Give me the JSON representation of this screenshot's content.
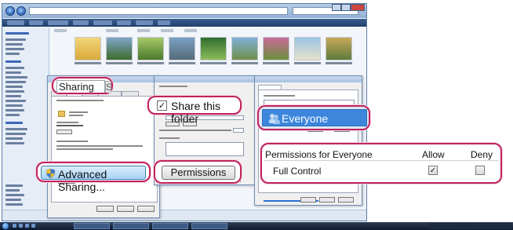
{
  "callouts": {
    "sharing_tab": {
      "label": "Sharing",
      "next_tab_fragment": "S"
    },
    "share_folder": {
      "label": "Share this folder",
      "checked": true
    },
    "user_entry": {
      "label": "Everyone",
      "selected": true
    },
    "permissions_table": {
      "header": "Permissions for Everyone",
      "allow_header": "Allow",
      "deny_header": "Deny",
      "rows": [
        {
          "name": "Full Control",
          "allow": true,
          "deny": false
        }
      ]
    },
    "advanced_sharing_button": {
      "label": "Advanced Sharing..."
    },
    "permissions_button": {
      "label": "Permissions"
    }
  },
  "colors": {
    "callout_border": "#c0235f",
    "selection_blue": "#3d86dc",
    "taskbar": "#0f1a2d"
  },
  "icons": {
    "users": "users-icon",
    "shield": "shield-icon",
    "folder": "folder-icon",
    "checkbox": "checkbox-icon",
    "start": "start-orb-icon"
  }
}
